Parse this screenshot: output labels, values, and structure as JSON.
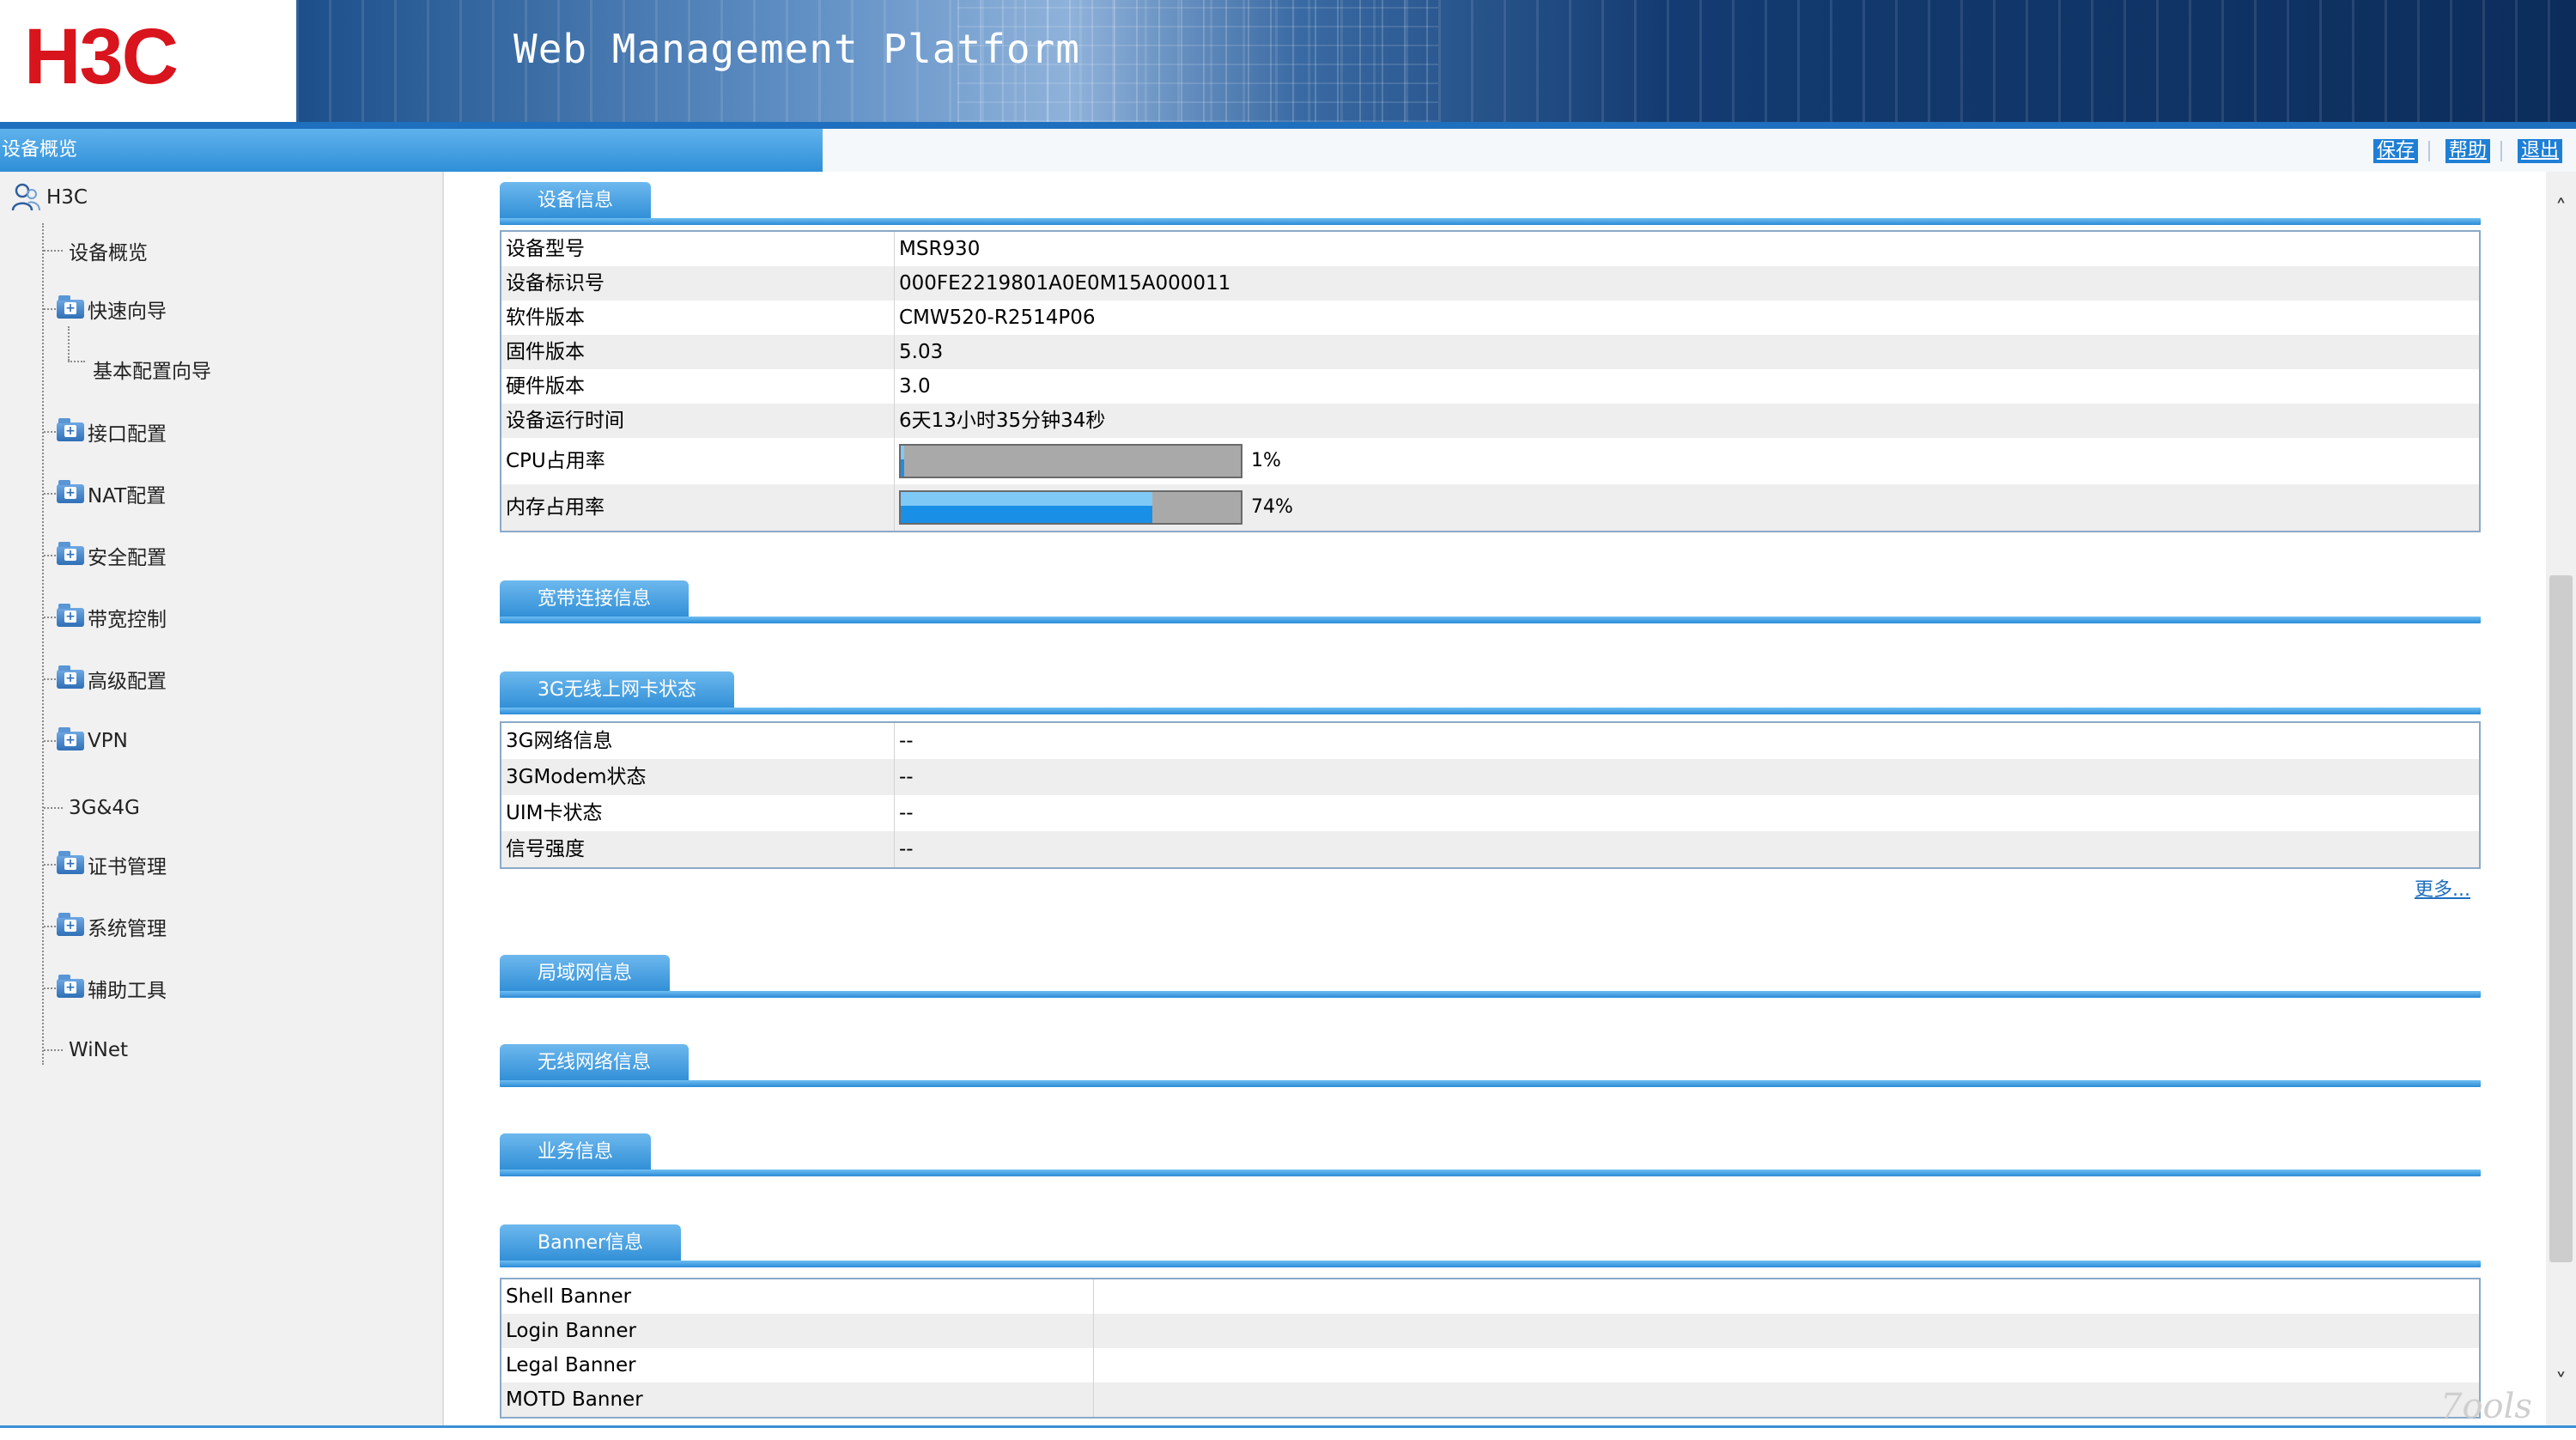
{
  "header": {
    "logo": "H3C",
    "title": "Web Management Platform"
  },
  "titlebar": {
    "current_page": "设备概览",
    "links": {
      "save": "保存",
      "help": "帮助",
      "logout": "退出"
    }
  },
  "sidebar": {
    "root": "H3C",
    "items": [
      {
        "label": "设备概览",
        "folder": false
      },
      {
        "label": "快速向导",
        "folder": true
      },
      {
        "label": "基本配置向导",
        "folder": false,
        "child": true
      },
      {
        "label": "接口配置",
        "folder": true
      },
      {
        "label": "NAT配置",
        "folder": true
      },
      {
        "label": "安全配置",
        "folder": true
      },
      {
        "label": "带宽控制",
        "folder": true
      },
      {
        "label": "高级配置",
        "folder": true
      },
      {
        "label": "VPN",
        "folder": true
      },
      {
        "label": "3G&4G",
        "folder": false
      },
      {
        "label": "证书管理",
        "folder": true
      },
      {
        "label": "系统管理",
        "folder": true
      },
      {
        "label": "辅助工具",
        "folder": true
      },
      {
        "label": "WiNet",
        "folder": false
      }
    ]
  },
  "sections": {
    "device_info": "设备信息",
    "broadband": "宽带连接信息",
    "wireless3g": "3G无线上网卡状态",
    "lan": "局域网信息",
    "wlan": "无线网络信息",
    "service": "业务信息",
    "banner": "Banner信息"
  },
  "device_info": {
    "rows": [
      {
        "label": "设备型号",
        "value": "MSR930"
      },
      {
        "label": "设备标识号",
        "value": "000FE2219801A0E0M15A000011"
      },
      {
        "label": "软件版本",
        "value": "CMW520-R2514P06"
      },
      {
        "label": "固件版本",
        "value": "5.03"
      },
      {
        "label": "硬件版本",
        "value": "3.0"
      },
      {
        "label": "设备运行时间",
        "value": "6天13小时35分钟34秒"
      }
    ],
    "cpu": {
      "label": "CPU占用率",
      "text": "1%",
      "percent": 1
    },
    "memory": {
      "label": "内存占用率",
      "text": "74%",
      "percent": 74
    }
  },
  "wireless3g": {
    "rows": [
      {
        "label": "3G网络信息",
        "value": "--"
      },
      {
        "label": "3GModem状态",
        "value": "--"
      },
      {
        "label": "UIM卡状态",
        "value": "--"
      },
      {
        "label": "信号强度",
        "value": "--"
      }
    ],
    "more": "更多..."
  },
  "banner_info": {
    "rows": [
      {
        "label": "Shell Banner",
        "value": ""
      },
      {
        "label": "Login Banner",
        "value": ""
      },
      {
        "label": "Legal Banner",
        "value": ""
      },
      {
        "label": "MOTD Banner",
        "value": ""
      }
    ]
  },
  "watermark": "7ools",
  "colors": {
    "accent": "#2f8ed6",
    "logo": "#d8141d",
    "header_bg": "#0c2d5c"
  }
}
